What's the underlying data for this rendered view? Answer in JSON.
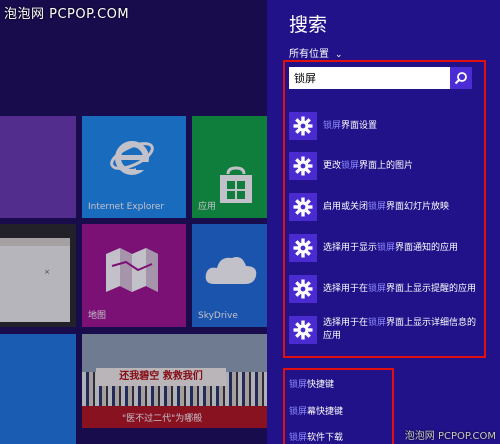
{
  "watermark_top": "泡泡网 PCPOP.COM",
  "watermark_bottom": "泡泡网 PCPOP.COM",
  "tiles": {
    "ie": "Internet Explorer",
    "store": "应用",
    "maps": "地图",
    "skydrive": "SkyDrive",
    "photo_banner": "还我碧空 救救我们",
    "photo_caption": "\"医不过二代\"为哪般"
  },
  "charm": {
    "title": "搜索",
    "scope": "所有位置",
    "query": "锁屏"
  },
  "results": [
    {
      "pre": "",
      "hl": "锁屏",
      "post": "界面设置"
    },
    {
      "pre": "更改",
      "hl": "锁屏",
      "post": "界面上的图片"
    },
    {
      "pre": "启用或关闭",
      "hl": "锁屏",
      "post": "界面幻灯片放映"
    },
    {
      "pre": "选择用于显示",
      "hl": "锁屏",
      "post": "界面通知的应用"
    },
    {
      "pre": "选择用于在",
      "hl": "锁屏",
      "post": "界面上显示提醒的应用"
    },
    {
      "pre": "选择用于在",
      "hl": "锁屏",
      "post": "界面上显示详细信息的应用"
    }
  ],
  "suggestions": [
    {
      "hl": "锁屏",
      "post": "快捷键"
    },
    {
      "hl": "锁屏",
      "post": "幕快捷键"
    },
    {
      "hl": "锁屏",
      "post": "软件下载"
    }
  ],
  "colors": {
    "charm_bg": "#21128a",
    "accent": "#4a2bd0",
    "highlight": "#8d8bff",
    "frame": "#e01010"
  }
}
